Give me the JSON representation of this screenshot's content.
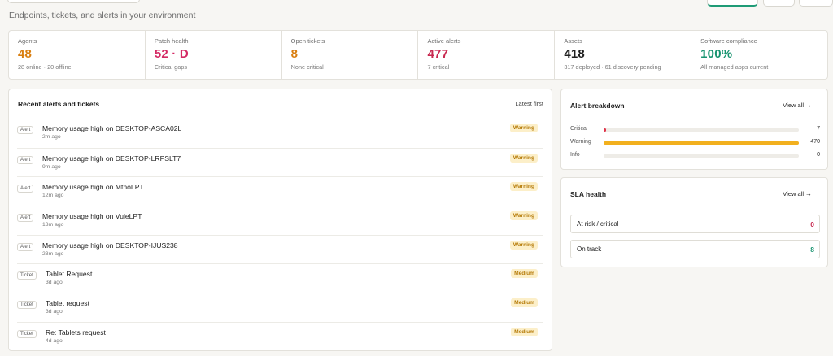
{
  "header": {
    "subtitle": "Endpoints, tickets, and alerts in your environment"
  },
  "stats": [
    {
      "label": "Agents",
      "value": "48",
      "sub": "28 online · 20 offline",
      "color": "#d97e0f"
    },
    {
      "label": "Patch health",
      "value": "52 · D",
      "sub": "Critical gaps",
      "color": "#d42a64"
    },
    {
      "label": "Open tickets",
      "value": "8",
      "sub": "None critical",
      "color": "#d97e0f"
    },
    {
      "label": "Active alerts",
      "value": "477",
      "sub": "7 critical",
      "color": "#c8284f"
    },
    {
      "label": "Assets",
      "value": "418",
      "sub": "317 deployed · 61 discovery pending",
      "color": "#1f1f1f"
    },
    {
      "label": "Software compliance",
      "value": "100%",
      "sub": "All managed apps current",
      "color": "#17936f"
    }
  ],
  "recent": {
    "title": "Recent alerts and tickets",
    "sort": "Latest first",
    "items": [
      {
        "kind": "Alert",
        "title": "Memory usage high on DESKTOP-ASCA02L",
        "time": "2m ago",
        "badge": "Warning"
      },
      {
        "kind": "Alert",
        "title": "Memory usage high on DESKTOP-LRPSLT7",
        "time": "9m ago",
        "badge": "Warning"
      },
      {
        "kind": "Alert",
        "title": "Memory usage high on MthoLPT",
        "time": "12m ago",
        "badge": "Warning"
      },
      {
        "kind": "Alert",
        "title": "Memory usage high on VuleLPT",
        "time": "13m ago",
        "badge": "Warning"
      },
      {
        "kind": "Alert",
        "title": "Memory usage high on DESKTOP-IJUS238",
        "time": "23m ago",
        "badge": "Warning"
      },
      {
        "kind": "Ticket",
        "title": "Tablet Request",
        "time": "3d ago",
        "badge": "Medium"
      },
      {
        "kind": "Ticket",
        "title": "Tablet request",
        "time": "3d ago",
        "badge": "Medium"
      },
      {
        "kind": "Ticket",
        "title": "Re: Tablets request",
        "time": "4d ago",
        "badge": "Medium"
      }
    ]
  },
  "breakdown": {
    "title": "Alert breakdown",
    "view_all": "View all",
    "rows": [
      {
        "label": "Critical",
        "count": "7",
        "fraction": 0.015,
        "color": "#e0344b"
      },
      {
        "label": "Warning",
        "count": "470",
        "fraction": 1.0,
        "color": "#f2b01e"
      },
      {
        "label": "Info",
        "count": "0",
        "fraction": 0,
        "color": "#9aa0a6"
      }
    ]
  },
  "sla": {
    "title": "SLA health",
    "view_all": "View all",
    "rows": [
      {
        "label": "At risk / critical",
        "value": "0",
        "color": "#c8284f"
      },
      {
        "label": "On track",
        "value": "8",
        "color": "#17936f"
      }
    ]
  }
}
